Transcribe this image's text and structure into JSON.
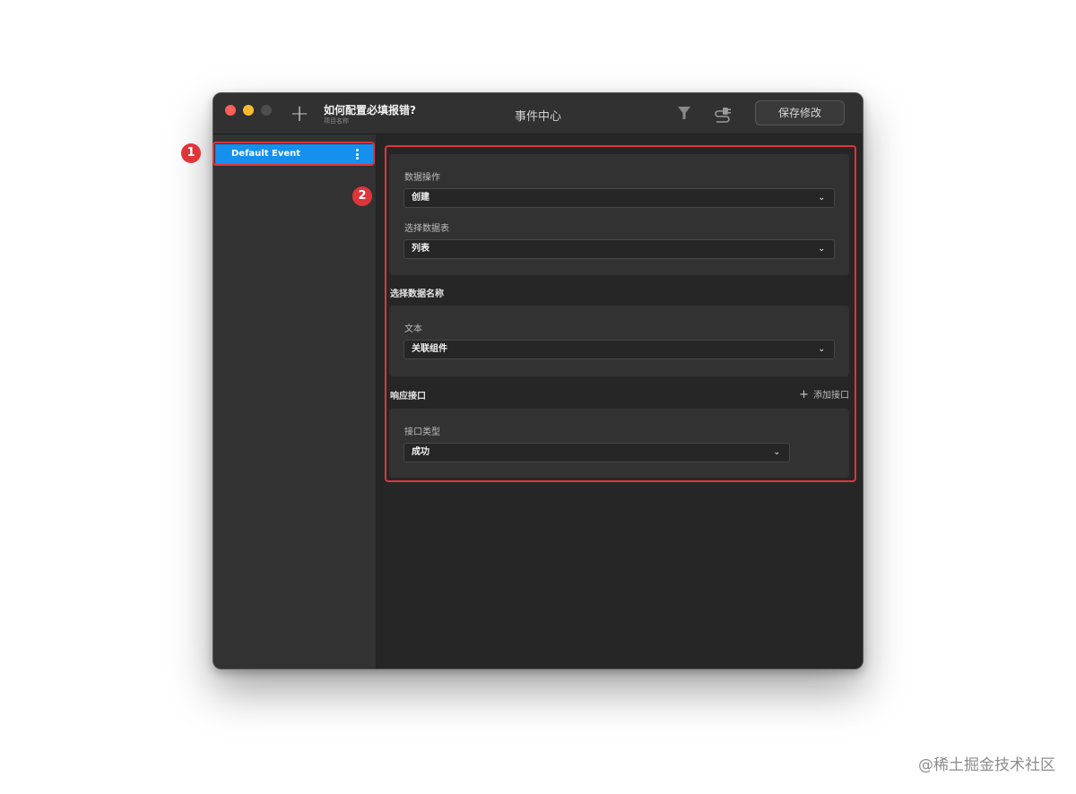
{
  "window": {
    "project_title": "如何配置必填报错?",
    "project_subtitle": "项目名称",
    "center_title": "事件中心",
    "save_label": "保存修改"
  },
  "sidebar": {
    "items": [
      {
        "label": "Default Event",
        "selected": true
      }
    ]
  },
  "form": {
    "data_operation_label": "数据操作",
    "data_operation_value": "创建",
    "data_table_label": "选择数据表",
    "data_table_value": "列表",
    "data_name_section": "选择数据名称",
    "text_label": "文本",
    "text_value": "关联组件",
    "response_section": "响应接口",
    "add_interface_label": "添加接口",
    "interface_type_label": "接口类型",
    "interface_type_value": "成功"
  },
  "annotations": {
    "badge1": "1",
    "badge2": "2"
  },
  "watermark": "@稀土掘金技术社区",
  "colors": {
    "accent": "#1590ee",
    "highlight": "#e0343b",
    "window_bg": "#262626"
  }
}
